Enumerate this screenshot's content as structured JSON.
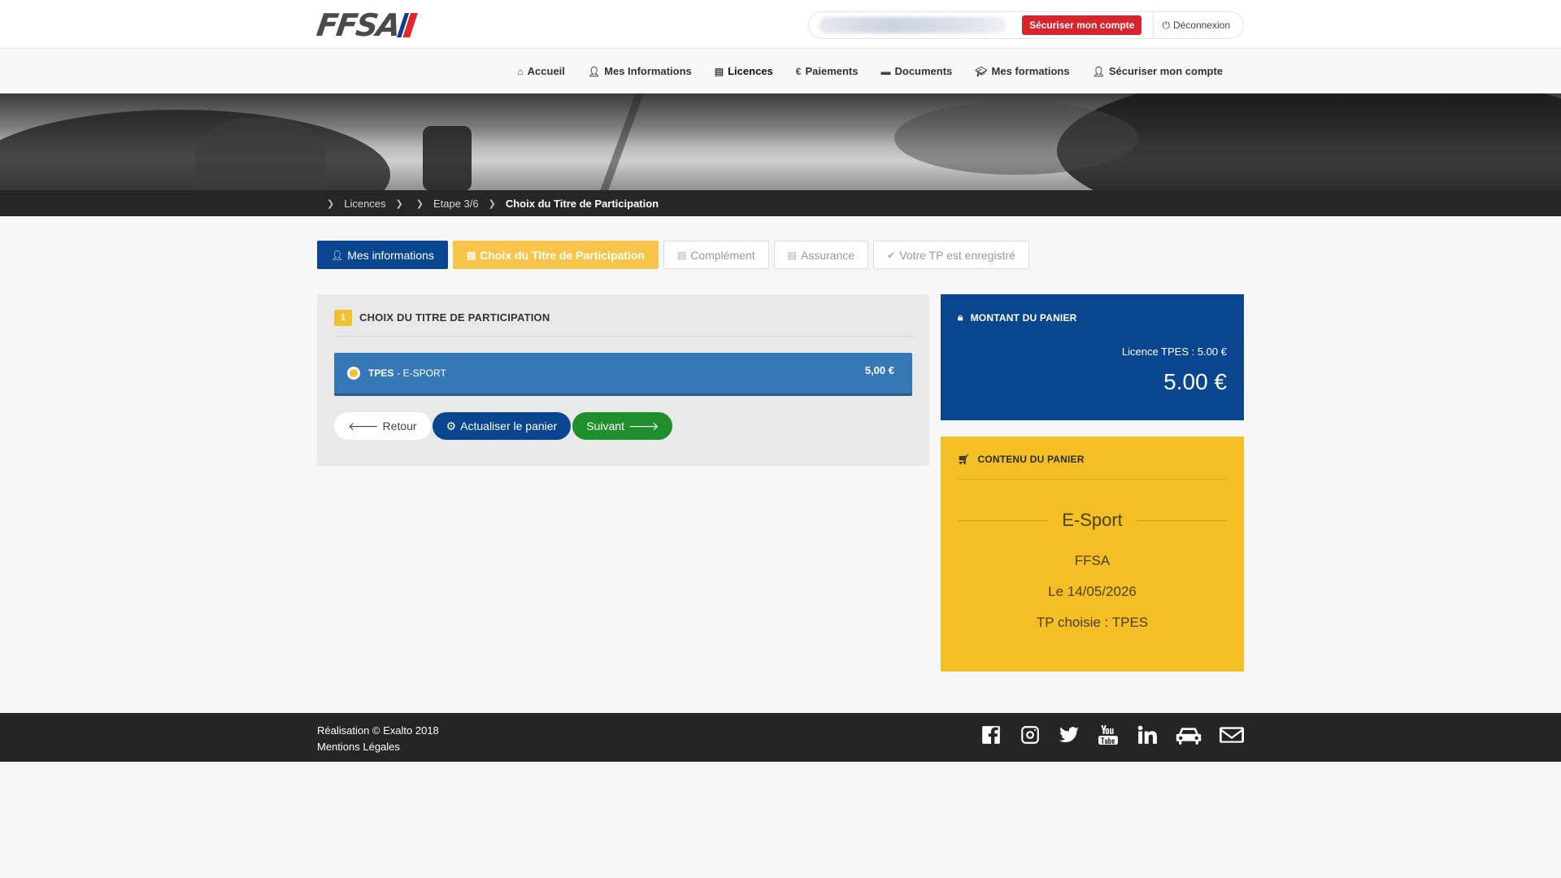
{
  "header": {
    "logo_text": "FFSA",
    "secure_label": "Sécuriser mon compte",
    "logout_label": "Déconnexion"
  },
  "nav": {
    "items": [
      {
        "label": "Accueil",
        "icon": "home-icon"
      },
      {
        "label": "Mes Informations",
        "icon": "user-icon"
      },
      {
        "label": "Licences",
        "icon": "id-card-icon"
      },
      {
        "label": "Paiements",
        "icon": "euro-icon"
      },
      {
        "label": "Documents",
        "icon": "folder-icon"
      },
      {
        "label": "Mes formations",
        "icon": "graduation-cap-icon"
      },
      {
        "label": "Sécuriser mon compte",
        "icon": "user-icon"
      }
    ]
  },
  "breadcrumb": {
    "items": [
      "Licences",
      "Etape 3/6",
      "Choix du Titre de Participation"
    ]
  },
  "steps": [
    {
      "label": "Mes informations",
      "icon": "user-icon"
    },
    {
      "label": "Choix du Titre de Participation",
      "icon": "id-card-icon"
    },
    {
      "label": "Complément",
      "icon": "id-card-icon"
    },
    {
      "label": "Assurance",
      "icon": "id-card-icon"
    },
    {
      "label": "Votre TP est enregistré",
      "icon": "check-circle-icon"
    }
  ],
  "panel": {
    "number": "1",
    "title": "CHOIX DU TITRE DE PARTICIPATION",
    "option": {
      "code": "TPES",
      "label": "- E-SPORT",
      "price": "5,00 €"
    },
    "buttons": {
      "back": "Retour",
      "refresh": "Actualiser le panier",
      "next": "Suivant"
    }
  },
  "total": {
    "title": "MONTANT DU PANIER",
    "line": "Licence TPES : 5.00 €",
    "amount": "5.00 €"
  },
  "cart": {
    "title": "CONTENU DU PANIER",
    "item_title": "E-Sport",
    "org": "FFSA",
    "date": "Le 14/05/2026",
    "tp": "TP choisie : TPES"
  },
  "footer": {
    "credit": "Réalisation © Exalto 2018",
    "legal": "Mentions Légales",
    "socials": [
      "facebook-icon",
      "instagram-icon",
      "twitter-icon",
      "youtube-icon",
      "linkedin-icon",
      "car-icon",
      "mail-icon"
    ]
  },
  "colors": {
    "brand_blue": "#0a468f",
    "brand_red": "#d9232d",
    "yellow": "#f4bf25",
    "option_blue": "#3678b5",
    "green": "#1f8f2e"
  }
}
